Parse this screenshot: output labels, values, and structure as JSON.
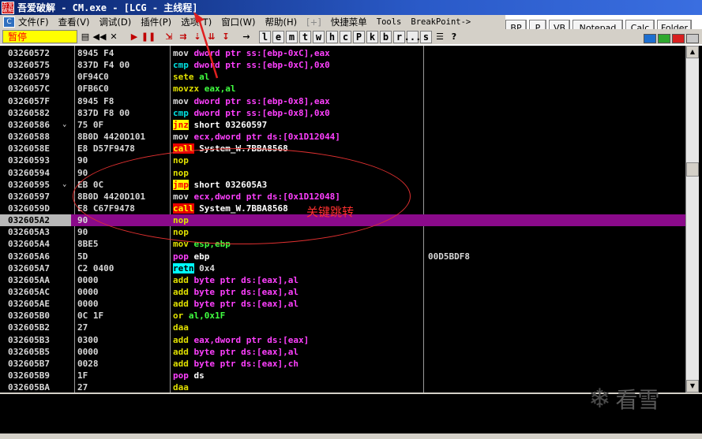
{
  "window": {
    "title": "吾爱破解 - CM.exe - [LCG - 主线程]",
    "icon_text": "吾爱破解"
  },
  "menu": {
    "items": [
      "文件(F)",
      "查看(V)",
      "调试(D)",
      "插件(P)",
      "选项(T)",
      "窗口(W)",
      "帮助(H)",
      "[+]",
      "快捷菜单",
      "Tools",
      "BreakPoint->"
    ]
  },
  "plugin_buttons": [
    "BP",
    "P",
    "VB",
    "Notepad",
    "Calc",
    "Folder"
  ],
  "toolbar": {
    "status": "暂停",
    "letters": [
      "l",
      "e",
      "m",
      "t",
      "w",
      "h",
      "c",
      "P",
      "k",
      "b",
      "r",
      "...",
      "s"
    ]
  },
  "annotation": {
    "label": "关键跳转"
  },
  "watermark": {
    "text": "看雪"
  },
  "rows": [
    {
      "addr": "03260572",
      "hex": "8945 F4",
      "mn": "mov",
      "mnc": "",
      "op": "dword ptr ss:[ebp-0xC],eax",
      "opc": "m",
      "cmt": ""
    },
    {
      "addr": "03260575",
      "hex": "837D F4 00",
      "mn": "cmp",
      "mnc": "c",
      "op": "dword ptr ss:[ebp-0xC],0x0",
      "opc": "m",
      "cmt": ""
    },
    {
      "addr": "03260579",
      "hex": "0F94C0",
      "mn": "sete",
      "mnc": "y",
      "op": "al",
      "opc": "g",
      "cmt": ""
    },
    {
      "addr": "0326057C",
      "hex": "0FB6C0",
      "mn": "movzx",
      "mnc": "y",
      "op": "eax,al",
      "opc": "g",
      "cmt": ""
    },
    {
      "addr": "0326057F",
      "hex": "8945 F8",
      "mn": "mov",
      "mnc": "",
      "op": "dword ptr ss:[ebp-0x8],eax",
      "opc": "m",
      "cmt": ""
    },
    {
      "addr": "03260582",
      "hex": "837D F8 00",
      "mn": "cmp",
      "mnc": "c",
      "op": "dword ptr ss:[ebp-0x8],0x0",
      "opc": "m",
      "cmt": ""
    },
    {
      "addr": "03260586",
      "hex": "75 0F",
      "mn": "jnz",
      "mnc": "jbox",
      "op": "short 03260597",
      "opc": "w",
      "cmt": "",
      "jmark": "⌄"
    },
    {
      "addr": "03260588",
      "hex": "8B0D 4420D101",
      "mn": "mov",
      "mnc": "",
      "op": "ecx,dword ptr ds:[0x1D12044]",
      "opc": "m",
      "cmt": ""
    },
    {
      "addr": "0326058E",
      "hex": "E8 D57F9478",
      "mn": "call",
      "mnc": "box",
      "op": "System_W.7BBA8568",
      "opc": "w",
      "cmt": ""
    },
    {
      "addr": "03260593",
      "hex": "90",
      "mn": "nop",
      "mnc": "y",
      "op": "",
      "opc": "",
      "cmt": ""
    },
    {
      "addr": "03260594",
      "hex": "90",
      "mn": "nop",
      "mnc": "y",
      "op": "",
      "opc": "",
      "cmt": ""
    },
    {
      "addr": "03260595",
      "hex": "EB 0C",
      "mn": "jmp",
      "mnc": "jbox",
      "op": "short 032605A3",
      "opc": "w",
      "cmt": "",
      "jmark": "⌄"
    },
    {
      "addr": "03260597",
      "hex": "8B0D 4420D101",
      "mn": "mov",
      "mnc": "",
      "op": "ecx,dword ptr ds:[0x1D12048]",
      "opc": "m",
      "cmt": ""
    },
    {
      "addr": "0326059D",
      "hex": "E8 C67F9478",
      "mn": "call",
      "mnc": "box",
      "op": "System_W.7BBA8568",
      "opc": "w",
      "cmt": ""
    },
    {
      "addr": "032605A2",
      "hex": "90",
      "mn": "nop",
      "mnc": "y",
      "op": "",
      "opc": "",
      "cmt": "",
      "hl": true
    },
    {
      "addr": "032605A3",
      "hex": "90",
      "mn": "nop",
      "mnc": "y",
      "op": "",
      "opc": "",
      "cmt": ""
    },
    {
      "addr": "032605A4",
      "hex": "8BE5",
      "mn": "mov",
      "mnc": "y",
      "op": "esp,ebp",
      "opc": "g",
      "cmt": ""
    },
    {
      "addr": "032605A6",
      "hex": "5D",
      "mn": "pop",
      "mnc": "m",
      "op": "ebp",
      "opc": "w",
      "cmt": "00D5BDF8"
    },
    {
      "addr": "032605A7",
      "hex": "C2 0400",
      "mn": "retn",
      "mnc": "rbox",
      "op": "0x4",
      "opc": "",
      "cmt": ""
    },
    {
      "addr": "032605AA",
      "hex": "0000",
      "mn": "add",
      "mnc": "y",
      "op": "byte ptr ds:[eax],al",
      "opc": "m",
      "cmt": ""
    },
    {
      "addr": "032605AC",
      "hex": "0000",
      "mn": "add",
      "mnc": "y",
      "op": "byte ptr ds:[eax],al",
      "opc": "m",
      "cmt": ""
    },
    {
      "addr": "032605AE",
      "hex": "0000",
      "mn": "add",
      "mnc": "y",
      "op": "byte ptr ds:[eax],al",
      "opc": "m",
      "cmt": ""
    },
    {
      "addr": "032605B0",
      "hex": "0C 1F",
      "mn": "or",
      "mnc": "y",
      "op": "al,0x1F",
      "opc": "g",
      "cmt": ""
    },
    {
      "addr": "032605B2",
      "hex": "27",
      "mn": "daa",
      "mnc": "y",
      "op": "",
      "opc": "",
      "cmt": ""
    },
    {
      "addr": "032605B3",
      "hex": "0300",
      "mn": "add",
      "mnc": "y",
      "op": "eax,dword ptr ds:[eax]",
      "opc": "m",
      "cmt": ""
    },
    {
      "addr": "032605B5",
      "hex": "0000",
      "mn": "add",
      "mnc": "y",
      "op": "byte ptr ds:[eax],al",
      "opc": "m",
      "cmt": ""
    },
    {
      "addr": "032605B7",
      "hex": "0028",
      "mn": "add",
      "mnc": "y",
      "op": "byte ptr ds:[eax],ch",
      "opc": "m",
      "cmt": ""
    },
    {
      "addr": "032605B9",
      "hex": "1F",
      "mn": "pop",
      "mnc": "m",
      "op": "ds",
      "opc": "w",
      "cmt": ""
    },
    {
      "addr": "032605BA",
      "hex": "27",
      "mn": "daa",
      "mnc": "y",
      "op": "",
      "opc": "",
      "cmt": ""
    }
  ]
}
